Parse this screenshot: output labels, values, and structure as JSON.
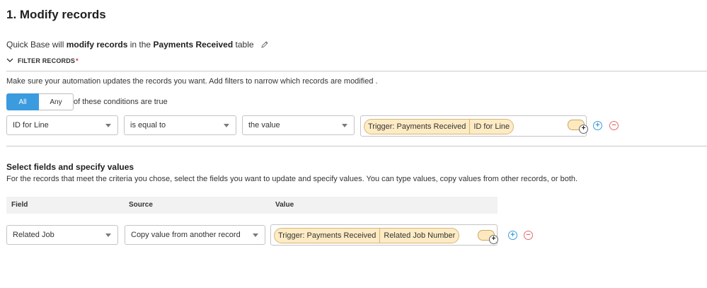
{
  "title": "1. Modify records",
  "intro": {
    "prefix": "Quick Base will",
    "action": "modify records",
    "mid": "in the",
    "table": "Payments Received",
    "suffix": "table"
  },
  "filter": {
    "header": "FILTER RECORDS",
    "required_mark": "*",
    "help": "Make sure your automation updates the records you want. Add filters to narrow which records are modified .",
    "match": {
      "all_label": "All",
      "any_label": "Any",
      "selected": "All",
      "suffix": "of these conditions are true"
    },
    "condition": {
      "field": "ID for Line",
      "operator": "is equal to",
      "value_type": "the value",
      "token_source": "Trigger: Payments Received",
      "token_field": "ID for Line"
    }
  },
  "fields_section": {
    "title": "Select fields and specify values",
    "help": "For the records that meet the criteria you chose, select the fields you want to update and specify values. You can type values, copy values from other records, or both.",
    "columns": [
      "Field",
      "Source",
      "Value"
    ],
    "row": {
      "field": "Related Job",
      "source": "Copy value from another record",
      "token_source": "Trigger: Payments Received",
      "token_field": "Related Job Number"
    }
  },
  "icons": {
    "pencil": "pencil-icon",
    "chevron": "chevron-down-icon",
    "add": "plus-circle-icon",
    "remove": "minus-circle-icon",
    "insert_field": "insert-field-toggle-icon"
  },
  "colors": {
    "accent": "#3b9bdf",
    "token_bg": "#fdebc4",
    "token_border": "#d7b77a",
    "remove": "#e06b6b",
    "required": "#d0333b"
  }
}
